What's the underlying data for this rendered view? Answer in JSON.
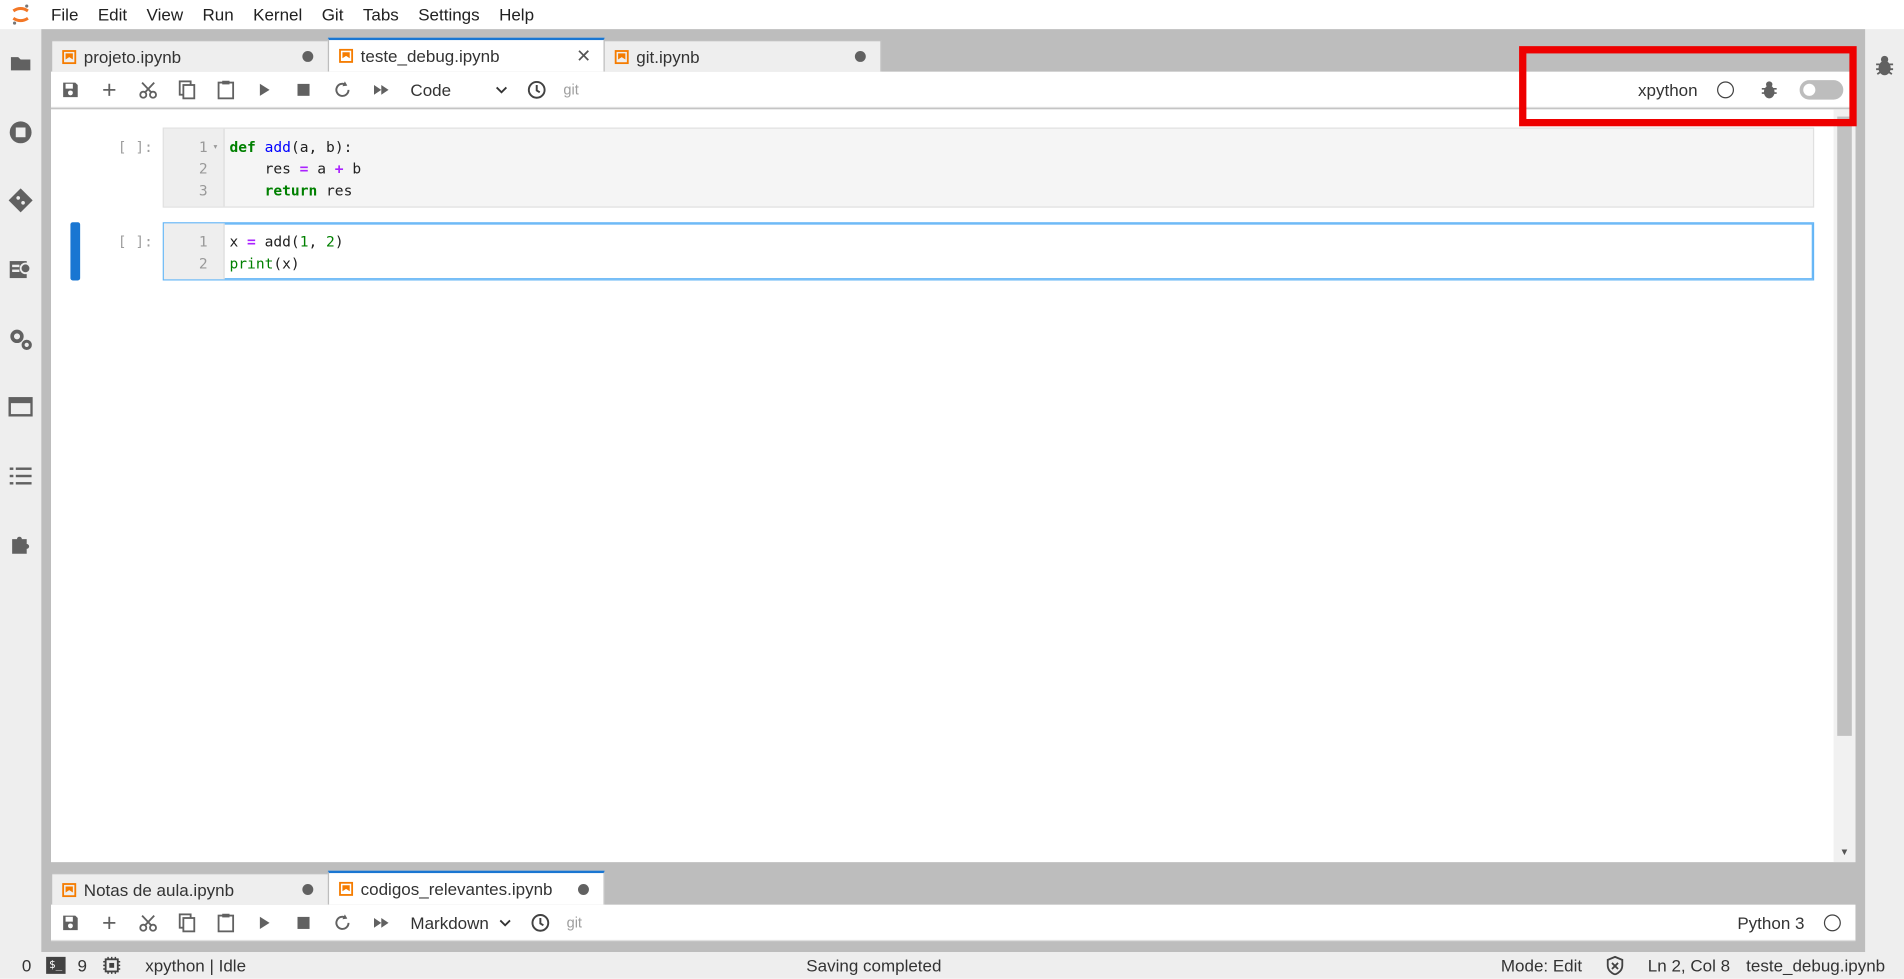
{
  "menu": [
    "File",
    "Edit",
    "View",
    "Run",
    "Kernel",
    "Git",
    "Tabs",
    "Settings",
    "Help"
  ],
  "sidebar_left_icons": [
    "folder-icon",
    "running-icon",
    "git-icon",
    "property-inspector-icon",
    "extension-settings-icon",
    "tabs-icon",
    "toc-icon",
    "puzzle-icon"
  ],
  "top_panel": {
    "tabs": [
      {
        "label": "projeto.ipynb",
        "state": "unsaved"
      },
      {
        "label": "teste_debug.ipynb",
        "state": "active"
      },
      {
        "label": "git.ipynb",
        "state": "unsaved"
      }
    ],
    "toolbar": {
      "cell_type": "Code",
      "git_label": "git",
      "kernel_name": "xpython",
      "debugger_toggle": "off"
    },
    "cells": [
      {
        "prompt": "[ ]:",
        "line_numbers": [
          "1",
          "2",
          "3"
        ]
      },
      {
        "prompt": "[ ]:",
        "line_numbers": [
          "1",
          "2"
        ]
      }
    ]
  },
  "bottom_panel": {
    "tabs": [
      {
        "label": "Notas de aula.ipynb",
        "state": "unsaved"
      },
      {
        "label": "codigos_relevantes.ipynb",
        "state": "active"
      }
    ],
    "toolbar": {
      "cell_type": "Markdown",
      "git_label": "git",
      "kernel_name": "Python 3"
    }
  },
  "status": {
    "terminals": "0",
    "kernels": "9",
    "kernel_status": "xpython | Idle",
    "message": "Saving completed",
    "mode": "Mode: Edit",
    "cursor": "Ln 2, Col 8",
    "filename": "teste_debug.ipynb"
  },
  "colors": {
    "accent": "#1976d2",
    "highlight": "#ee0000",
    "notebook_icon": "#f57c00"
  }
}
